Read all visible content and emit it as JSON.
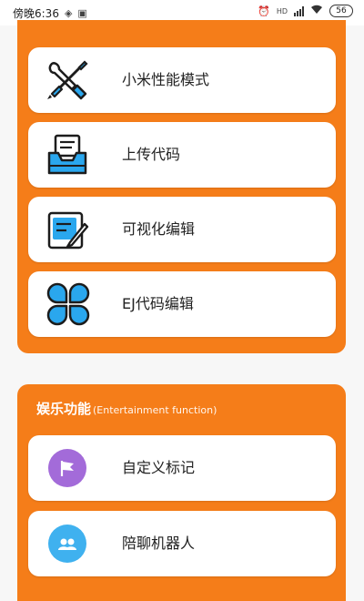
{
  "status_bar": {
    "time": "傍晚6:36",
    "battery": "56",
    "network_label": "HD"
  },
  "menu": {
    "items": [
      {
        "label": "小米性能模式",
        "icon": "tools-icon"
      },
      {
        "label": "上传代码",
        "icon": "upload-tray-icon"
      },
      {
        "label": "可视化编辑",
        "icon": "edit-document-icon"
      },
      {
        "label": "EJ代码编辑",
        "icon": "four-petal-icon"
      }
    ]
  },
  "entertainment": {
    "title": "娱乐功能",
    "subtitle": "(Entertainment function)",
    "items": [
      {
        "label": "自定义标记",
        "icon": "flag-icon",
        "color": "#a36bd9"
      },
      {
        "label": "陪聊机器人",
        "icon": "robot-icon",
        "color": "#3fb1ef"
      }
    ]
  },
  "colors": {
    "accent": "#f57d19",
    "card_bg": "#ffffff",
    "icon_blue": "#2aa7ee"
  }
}
